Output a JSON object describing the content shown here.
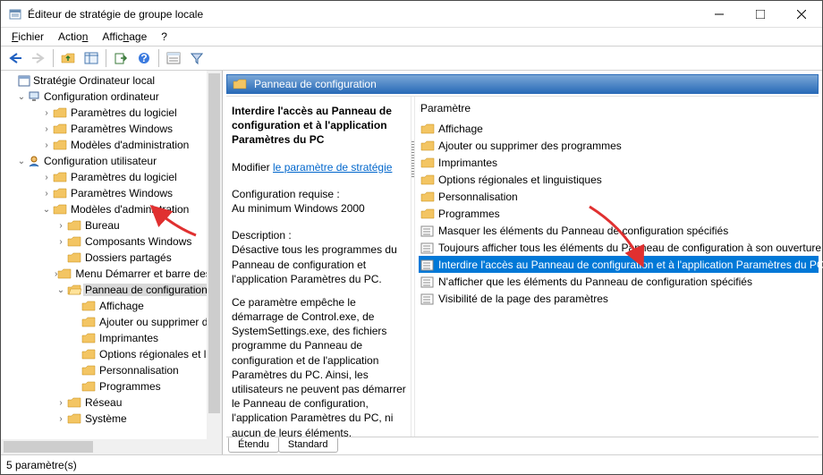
{
  "window": {
    "title": "Éditeur de stratégie de groupe locale"
  },
  "menubar": {
    "file": "Fichier",
    "action": "Action",
    "view": "Affichage",
    "help": "?"
  },
  "tree": {
    "root": "Stratégie Ordinateur local",
    "computer": {
      "label": "Configuration ordinateur",
      "software": "Paramètres du logiciel",
      "windows": "Paramètres Windows",
      "admin": "Modèles d'administration"
    },
    "user": {
      "label": "Configuration utilisateur",
      "software": "Paramètres du logiciel",
      "windows": "Paramètres Windows",
      "admin": {
        "label": "Modèles d'administration",
        "children": {
          "bureau": "Bureau",
          "composants": "Composants Windows",
          "dossiers": "Dossiers partagés",
          "menu": "Menu Démarrer et barre des tâches",
          "panneau": {
            "label": "Panneau de configuration",
            "children": {
              "affichage": "Affichage",
              "ajouter": "Ajouter ou supprimer des programmes",
              "imprimantes": "Imprimantes",
              "options": "Options régionales et linguistiques",
              "personnalisation": "Personnalisation",
              "programmes": "Programmes"
            }
          },
          "reseau": "Réseau",
          "systeme": "Système"
        }
      }
    }
  },
  "right": {
    "header": "Panneau de configuration",
    "detail": {
      "setting_title": "Interdire l'accès au Panneau de configuration et à l'application Paramètres du PC",
      "edit_label": "Modifier ",
      "edit_link": "le paramètre de stratégie",
      "req_label": "Configuration requise :",
      "req_value": "Au minimum Windows 2000",
      "desc_label": "Description :",
      "desc_p1": "Désactive tous les programmes du Panneau de configuration et l'application Paramètres du PC.",
      "desc_p2": "Ce paramètre empêche le démarrage de Control.exe, de SystemSettings.exe, des fichiers programme du Panneau de configuration et de l'application Paramètres du PC. Ainsi, les utilisateurs ne peuvent pas démarrer le Panneau de configuration, l'application Paramètres du PC, ni aucun de leurs éléments."
    },
    "list": {
      "header": "Paramètre",
      "folders": [
        "Affichage",
        "Ajouter ou supprimer des programmes",
        "Imprimantes",
        "Options régionales et linguistiques",
        "Personnalisation",
        "Programmes"
      ],
      "settings": [
        "Masquer les éléments du Panneau de configuration spécifiés",
        "Toujours afficher tous les éléments du Panneau de configuration à son ouverture",
        "Interdire l'accès au Panneau de configuration et à l'application Paramètres du PC",
        "N'afficher que les éléments du Panneau de configuration spécifiés",
        "Visibilité de la page des paramètres"
      ],
      "selected_index": 2
    },
    "tabs": {
      "extended": "Étendu",
      "standard": "Standard"
    }
  },
  "status": {
    "text": "5 paramètre(s)"
  }
}
